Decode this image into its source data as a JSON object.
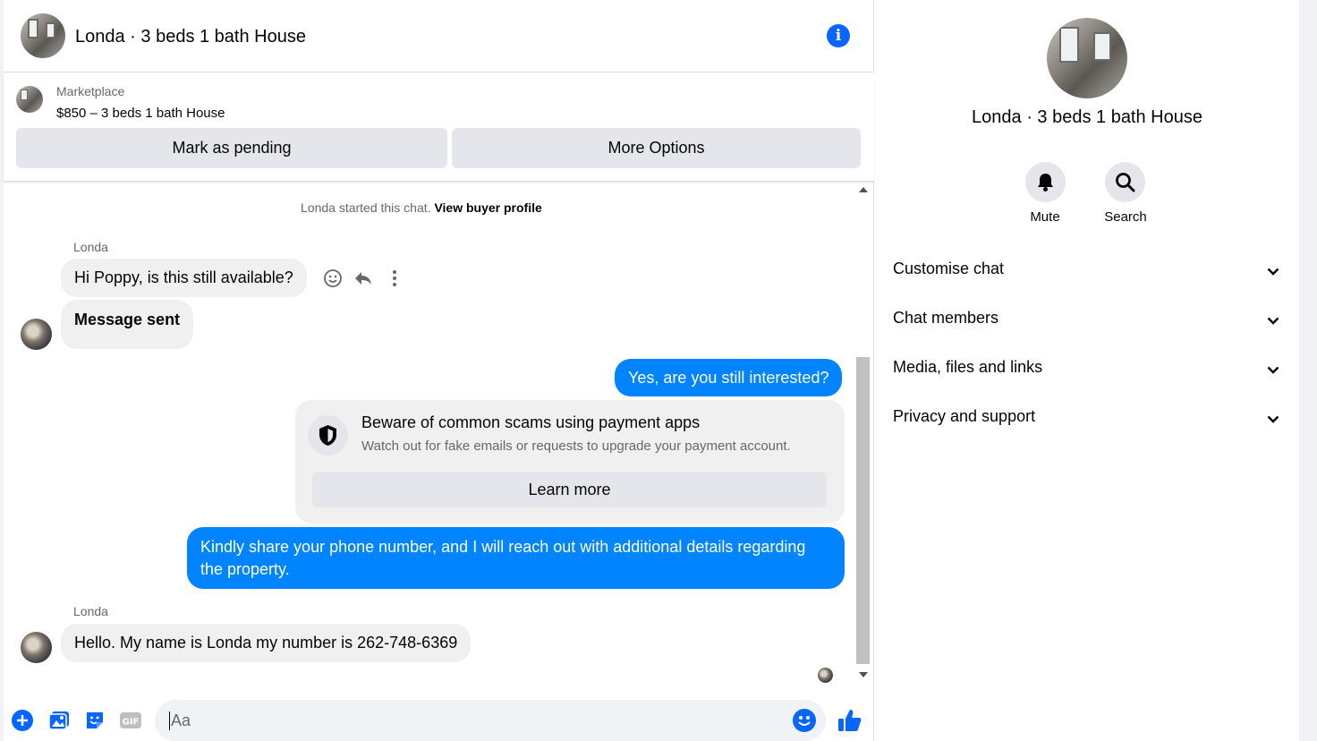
{
  "chat": {
    "title": "Londa · 3 beds 1 bath House",
    "marketplace": {
      "label": "Marketplace",
      "item": "$850 – 3 beds 1 bath House",
      "pending_button": "Mark as pending",
      "more_button": "More Options"
    },
    "started_text": "Londa started this chat.",
    "view_profile": "View buyer profile",
    "messages": [
      {
        "sender": "Londa",
        "text": "Hi Poppy, is this still available?"
      },
      {
        "text": "Message sent"
      },
      {
        "text": "Yes, are you still interested?"
      },
      {
        "text": "Kindly share your phone number, and I will reach out with additional details regarding the property."
      },
      {
        "sender": "Londa",
        "text": "Hello. My name is Londa my number is 262-748-6369"
      }
    ],
    "scam_notice": {
      "title": "Beware of common scams using payment apps",
      "text": "Watch out for fake emails or requests to upgrade your payment account.",
      "button": "Learn more"
    },
    "composer": {
      "placeholder": "Aa",
      "icons": [
        "plus-icon",
        "photo-icon",
        "sticker-icon",
        "gif-icon",
        "emoji-icon",
        "thumbs-up-icon"
      ],
      "gif_label": "GIF"
    }
  },
  "panel": {
    "title": "Londa · 3 beds 1 bath House",
    "mute": "Mute",
    "search": "Search",
    "sections": [
      "Customise chat",
      "Chat members",
      "Media, files and links",
      "Privacy and support"
    ]
  },
  "colors": {
    "accent": "#0866ff",
    "outgoing_bubble": "#0084ff",
    "incoming_bubble": "#f0f0f0",
    "button_grey": "#e4e6eb"
  }
}
